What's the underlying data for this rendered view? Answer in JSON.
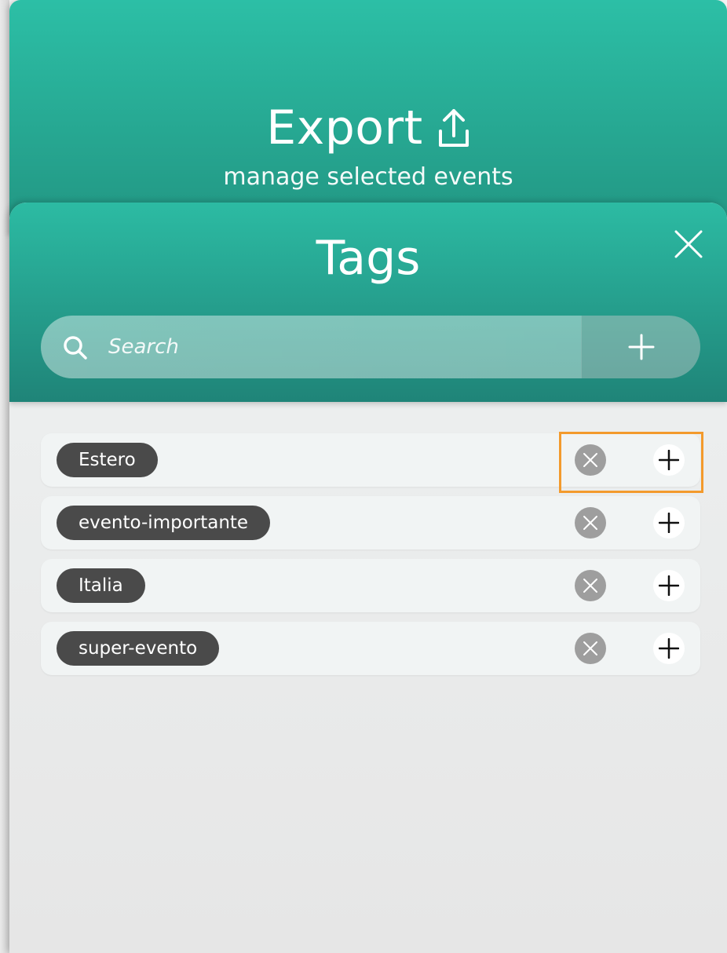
{
  "export": {
    "title": "Export",
    "subtitle": "manage selected events",
    "icon": "upload-icon"
  },
  "tags": {
    "title": "Tags",
    "close_icon": "close-icon",
    "search": {
      "placeholder": "Search",
      "value": "",
      "icon": "search-icon"
    },
    "add_icon": "plus-icon",
    "items": [
      {
        "label": "Estero"
      },
      {
        "label": "evento-importante"
      },
      {
        "label": "Italia"
      },
      {
        "label": "super-evento"
      }
    ]
  },
  "colors": {
    "header_teal_top": "#2cbfa6",
    "header_teal_bottom": "#1f8478",
    "tag_pill": "#4a4a4a",
    "remove_button": "#9e9e9e",
    "highlight": "#f39a2c"
  }
}
